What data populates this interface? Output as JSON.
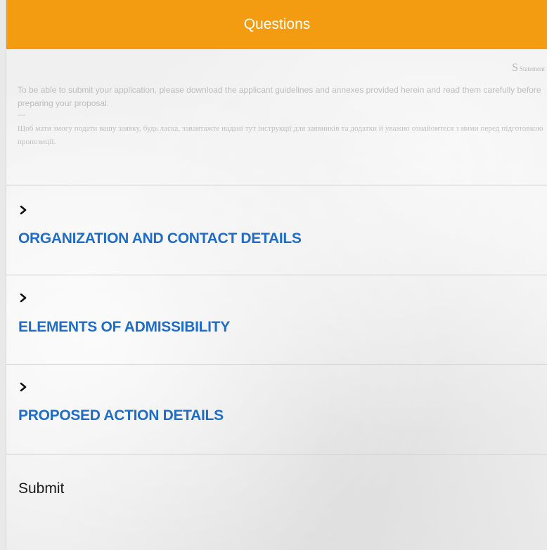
{
  "header": {
    "title": "Questions"
  },
  "statement": {
    "tag_letter": "S",
    "tag_label": "Statement",
    "text_en": "To be able to submit your application, please download the applicant guidelines and annexes provided herein and read them carefully before preparing your proposal.",
    "separator": "---",
    "text_uk": "Щоб мати змогу подати вашу заявку, будь ласка, завантажте надані тут інструкції для заявників та додатки й уважно ознайомтеся з ними перед підготовкою пропозиції."
  },
  "sections": [
    {
      "title": "ORGANIZATION AND CONTACT DETAILS",
      "expanded": false
    },
    {
      "title": "ELEMENTS OF ADMISSIBILITY",
      "expanded": false
    },
    {
      "title": "PROPOSED ACTION DETAILS",
      "expanded": false
    }
  ],
  "submit": {
    "label": "Submit"
  },
  "colors": {
    "header_bg": "#f39c12",
    "section_title": "#1f6dc6",
    "statement_text": "#bdbdbd"
  }
}
